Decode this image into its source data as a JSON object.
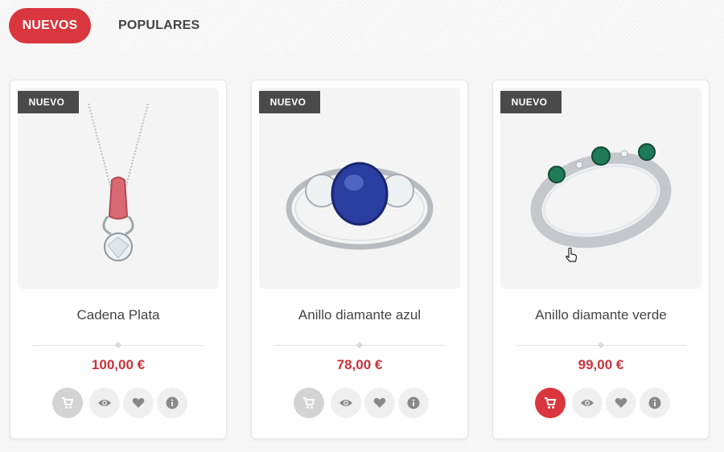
{
  "tabs": [
    {
      "label": "NUEVOS",
      "active": true
    },
    {
      "label": "POPULARES",
      "active": false
    }
  ],
  "products": [
    {
      "badge": "NUEVO",
      "name": "Cadena Plata",
      "price": "100,00 €",
      "image": "pendant-necklace"
    },
    {
      "badge": "NUEVO",
      "name": "Anillo diamante azul",
      "price": "78,00 €",
      "image": "blue-sapphire-ring"
    },
    {
      "badge": "NUEVO",
      "name": "Anillo diamante verde",
      "price": "99,00 €",
      "image": "green-stone-band-ring"
    }
  ],
  "actions": {
    "cart_icon": "cart-icon",
    "view_icon": "eye-icon",
    "wishlist_icon": "heart-icon",
    "info_icon": "info-icon"
  },
  "colors": {
    "accent": "#d9363e",
    "price": "#c8323a",
    "badge": "#4a4a4a"
  }
}
